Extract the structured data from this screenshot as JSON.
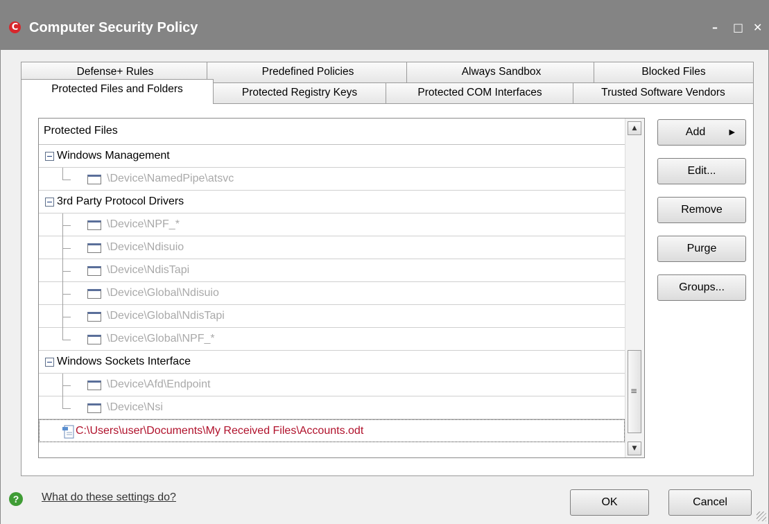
{
  "window": {
    "title": "Computer Security Policy",
    "logo_letter": "C",
    "minimize_glyph": "–",
    "maximize_glyph": "□",
    "close_glyph": "✕"
  },
  "tabs_row1": [
    "Defense+ Rules",
    "Predefined Policies",
    "Always Sandbox",
    "Blocked Files"
  ],
  "tabs_row2": [
    "Protected Files and Folders",
    "Protected Registry Keys",
    "Protected COM Interfaces",
    "Trusted Software Vendors"
  ],
  "active_tab": "Protected Files and Folders",
  "list": {
    "header": "Protected Files",
    "groups": [
      {
        "name": "Windows Management",
        "items": [
          "\\Device\\NamedPipe\\atsvc"
        ]
      },
      {
        "name": "3rd Party Protocol Drivers",
        "items": [
          "\\Device\\NPF_*",
          "\\Device\\Ndisuio",
          "\\Device\\NdisTapi",
          "\\Device\\Global\\Ndisuio",
          "\\Device\\Global\\NdisTapi",
          "\\Device\\Global\\NPF_*"
        ]
      },
      {
        "name": "Windows Sockets Interface",
        "items": [
          "\\Device\\Afd\\Endpoint",
          "\\Device\\Nsi"
        ]
      }
    ],
    "selected_item": "C:\\Users\\user\\Documents\\My Received Files\\Accounts.odt"
  },
  "side_buttons": {
    "add": "Add",
    "edit": "Edit...",
    "remove": "Remove",
    "purge": "Purge",
    "groups": "Groups..."
  },
  "footer": {
    "help_link": "What do these settings do?",
    "ok": "OK",
    "cancel": "Cancel"
  },
  "colors": {
    "titlebar": "#848484",
    "selected_text": "#b0112b",
    "disabled_text": "#a9a9a9",
    "help_icon": "#3f9c35",
    "logo": "#d7262b"
  }
}
